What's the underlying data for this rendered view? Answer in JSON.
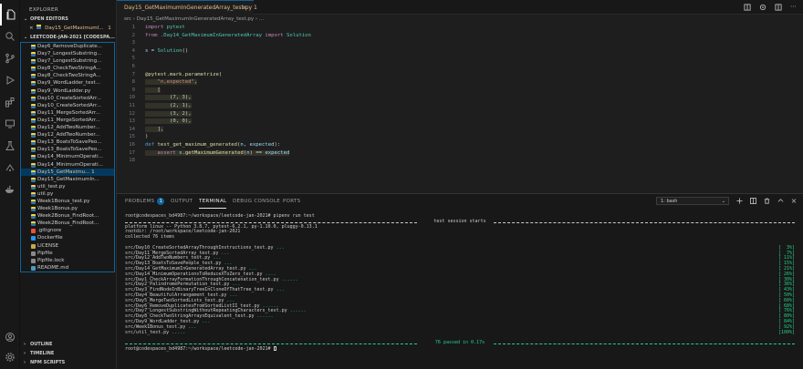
{
  "sidebar": {
    "title": "EXPLORER",
    "open_editors_label": "OPEN EDITORS",
    "open_editor_file": "Day15_GetMaximumI...",
    "open_editor_status": "1",
    "workspace_label": "LEETCODE-JAN-2021 [CODESPA...",
    "files": [
      {
        "name": "Day6_RemoveDuplicate...",
        "type": "py"
      },
      {
        "name": "Day7_LongestSubstring...",
        "type": "py"
      },
      {
        "name": "Day7_LongestSubstring...",
        "type": "py"
      },
      {
        "name": "Day8_CheckTwoStringA...",
        "type": "py"
      },
      {
        "name": "Day8_CheckTwoStringA...",
        "type": "py"
      },
      {
        "name": "Day9_WordLadder_test...",
        "type": "py"
      },
      {
        "name": "Day9_WordLadder.py",
        "type": "py"
      },
      {
        "name": "Day10_CreateSortedArr...",
        "type": "py"
      },
      {
        "name": "Day10_CreateSortedArr...",
        "type": "py"
      },
      {
        "name": "Day11_MergeSortedArr...",
        "type": "py"
      },
      {
        "name": "Day11_MergeSortedArr...",
        "type": "py"
      },
      {
        "name": "Day12_AddTwoNumber...",
        "type": "py"
      },
      {
        "name": "Day12_AddTwoNumber...",
        "type": "py"
      },
      {
        "name": "Day13_BoatsToSavePeo...",
        "type": "py"
      },
      {
        "name": "Day13_BoatsToSavePeo...",
        "type": "py"
      },
      {
        "name": "Day14_MinimumOperati...",
        "type": "py"
      },
      {
        "name": "Day14_MinimumOperati...",
        "type": "py"
      },
      {
        "name": "Day15_GetMaximu... 1",
        "type": "py",
        "selected": true
      },
      {
        "name": "Day15_GetMaximumIn...",
        "type": "py"
      },
      {
        "name": "util_test.py",
        "type": "py"
      },
      {
        "name": "util.py",
        "type": "py"
      },
      {
        "name": "Week1Bonus_test.py",
        "type": "py"
      },
      {
        "name": "Week1Bonus.py",
        "type": "py"
      },
      {
        "name": "Week2Bonus_FindRoot...",
        "type": "py"
      },
      {
        "name": "Week2Bonus_FindRoot...",
        "type": "py"
      },
      {
        "name": ".gitignore",
        "type": "git"
      },
      {
        "name": "Dockerfile",
        "type": "dock"
      },
      {
        "name": "LICENSE",
        "type": "lic"
      },
      {
        "name": "Pipfile",
        "type": "pip"
      },
      {
        "name": "Pipfile.lock",
        "type": "pip"
      },
      {
        "name": "README.md",
        "type": "md"
      }
    ],
    "outline_label": "OUTLINE",
    "timeline_label": "TIMELINE",
    "npm_label": "NPM SCRIPTS"
  },
  "editor": {
    "tab_label": "Day15_GetMaximumInGeneratedArray_test.py  1",
    "tab_close": "×",
    "breadcrumb": "src  ›  Day15_GetMaximumInGeneratedArray_test.py  ›  ...",
    "lines": [
      {
        "n": "1",
        "html": "<span class='kw'>import</span> <span class='cls'>pytest</span>"
      },
      {
        "n": "2",
        "html": "<span class='kw'>from</span> <span class='cls'>.Day14_GetMaximumInGeneratedArray</span> <span class='kw'>import</span> <span class='cls'>Solution</span>"
      },
      {
        "n": "3",
        "html": ""
      },
      {
        "n": "4",
        "html": "<span class='var'>s</span> <span class='op'>=</span> <span class='cls'>Solution</span><span class='op'>()</span>"
      },
      {
        "n": "5",
        "html": ""
      },
      {
        "n": "6",
        "html": ""
      },
      {
        "n": "7",
        "html": "<span class='fn'>@pytest.mark.parametrize</span><span class='op'>(</span>"
      },
      {
        "n": "8",
        "html": "    <span class='str'>\"n,expected\"</span><span class='op'>,</span>",
        "hl": true
      },
      {
        "n": "9",
        "html": "    <span class='op'>[</span>",
        "hl": true
      },
      {
        "n": "10",
        "html": "        <span class='op'>(</span><span class='num'>7</span><span class='op'>,</span> <span class='num'>3</span><span class='op'>),</span>",
        "hl": true
      },
      {
        "n": "11",
        "html": "        <span class='op'>(</span><span class='num'>2</span><span class='op'>,</span> <span class='num'>1</span><span class='op'>),</span>",
        "hl": true
      },
      {
        "n": "12",
        "html": "        <span class='op'>(</span><span class='num'>3</span><span class='op'>,</span> <span class='num'>2</span><span class='op'>),</span>",
        "hl": true
      },
      {
        "n": "13",
        "html": "        <span class='op'>(</span><span class='num'>0</span><span class='op'>,</span> <span class='num'>0</span><span class='op'>),</span>",
        "hl": true
      },
      {
        "n": "14",
        "html": "    <span class='op'>],</span>",
        "hl": true
      },
      {
        "n": "15",
        "html": "<span class='op'>)</span>"
      },
      {
        "n": "16",
        "html": "<span class='kw2'>def</span> <span class='fn'>test_get_maximum_generated</span><span class='op'>(</span><span class='var'>n</span><span class='op'>,</span> <span class='var'>expected</span><span class='op'>):</span>"
      },
      {
        "n": "17",
        "html": "    <span class='kw'>assert</span> <span class='var'>s</span><span class='op'>.</span><span class='fn'>getMaximumGenerated</span><span class='op'>(</span><span class='var'>n</span><span class='op'>) ==</span> <span class='var'>expected</span>",
        "hl": true
      },
      {
        "n": "18",
        "html": ""
      }
    ]
  },
  "panel": {
    "tabs": {
      "problems": "PROBLEMS",
      "problems_count": "1",
      "output": "OUTPUT",
      "terminal": "TERMINAL",
      "debug": "DEBUG CONSOLE",
      "ports": "PORTS"
    },
    "shell_select": "1: bash",
    "prompt1": "root@codespaces_bd4987:~/workspace/leetcode-jan-2021# pipenv run test",
    "session_header": "test session starts",
    "platform": "platform linux -- Python 3.8.7, pytest-6.2.1, py-1.10.0, pluggy-0.13.1",
    "rootdir": "rootdir: /root/workspace/leetcode-jan-2021",
    "collected": "collected 76 items",
    "results": [
      {
        "file": "src/Day10_CreateSortedArrayThroughInstructions_test.py",
        "dots": "...",
        "pct": "[  3%]"
      },
      {
        "file": "src/Day11_MergeSortedArray_test.py",
        "dots": "...",
        "pct": "[  7%]"
      },
      {
        "file": "src/Day12_AddTwoNumbers_test.py",
        "dots": "...",
        "pct": "[ 11%]"
      },
      {
        "file": "src/Day13_BoatsToSavePeople_test.py",
        "dots": "...",
        "pct": "[ 15%]"
      },
      {
        "file": "src/Day14_GetMaximumInGeneratedArray_test.py",
        "dots": "...",
        "pct": "[ 21%]"
      },
      {
        "file": "src/Day14_MinimumOperationsToReduceXToZero_test.py",
        "dots": "....",
        "pct": "[ 26%]"
      },
      {
        "file": "src/Day1_CheckArrayFormationThroughConcatenation_test.py",
        "dots": "......",
        "pct": "[ 30%]"
      },
      {
        "file": "src/Day2_PalindromePermutation_test.py",
        "dots": "...",
        "pct": "[ 36%]"
      },
      {
        "file": "src/Day3_FindNodeInBinaryTreeInCloneOfThatTree_test.py",
        "dots": "...",
        "pct": "[ 43%]"
      },
      {
        "file": "src/Day4_BeautifulArrangement_test.py",
        "dots": "...",
        "pct": "[ 50%]"
      },
      {
        "file": "src/Day5_MergeTwoSortedLists_test.py",
        "dots": "...",
        "pct": "[ 60%]"
      },
      {
        "file": "src/Day6_RemoveDuplicatesFromSortedListII_test.py",
        "dots": "......",
        "pct": "[ 68%]"
      },
      {
        "file": "src/Day7_LongestSubstringWithoutRepeatingCharacters_test.py",
        "dots": "......",
        "pct": "[ 76%]"
      },
      {
        "file": "src/Day8_CheckTwoStringArraysEquivalent_test.py",
        "dots": "......",
        "pct": "[ 80%]"
      },
      {
        "file": "src/Day9_WordLadder_test.py",
        "dots": "...",
        "pct": "[ 84%]"
      },
      {
        "file": "src/Week1Bonus_test.py",
        "dots": "...",
        "pct": "[ 92%]"
      },
      {
        "file": "src/util_test.py",
        "dots": ".....",
        "pct": "[100%]"
      }
    ],
    "summary": "76 passed in 0.17s",
    "prompt2": "root@codespaces_bd4987:~/workspace/leetcode-jan-2021# "
  },
  "colors": {
    "accent": "#0e639c",
    "pass": "#23d18b",
    "modified": "#e2c08d"
  }
}
